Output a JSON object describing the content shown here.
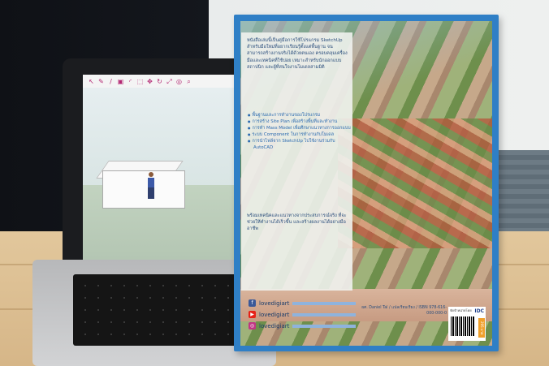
{
  "book": {
    "blurb_intro": "หนังสือเล่มนี้เป็นคู่มือการใช้โปรแกรม SketchUp สำหรับมือใหม่ที่อยากเรียนรู้ตั้งแต่พื้นฐาน จนสามารถสร้างงานจริงได้ด้วยตนเอง ครอบคลุมเครื่องมือและเทคนิคที่ใช้บ่อย เหมาะสำหรับนักออกแบบ สถาปนิก และผู้ที่สนใจงานโมเดลสามมิติ",
    "bullets": [
      "พื้นฐานและการทำงานของโปรแกรม",
      "การสร้าง Site Plan เพื่อสร้างพื้นที่และทำงาน",
      "การทำ Mass Model เพื่อศึกษาแนวทางการออกแบบ",
      "ระบบ Component ในการทำงานกับโมเดล",
      "การนำไฟล์จาก SketchUp ไปใช้งานร่วมกับ AutoCAD"
    ],
    "blurb_outro": "พร้อมเทคนิคและแนวทางจากประสบการณ์จริง ที่จะช่วยให้ทำงานได้เร็วขึ้น และสร้างผลงานได้อย่างมืออาชีพ",
    "social": [
      {
        "icon": "facebook-icon",
        "handle": "lovedigiart",
        "color": "#3b5998"
      },
      {
        "icon": "youtube-icon",
        "handle": "lovedigiart",
        "color": "#e62117"
      },
      {
        "icon": "instagram-icon",
        "handle": "lovedigiart",
        "color": "#c13584"
      }
    ],
    "credits": "ผศ. Daniel Tal / แปลเรียบเรียง / ISBN 978-616-000-000-0",
    "publisher_logo": "IDC",
    "pub_text": "จัดจำหน่ายโดย",
    "price_text": "295 บาท"
  },
  "laptop": {
    "app": "SketchUp"
  },
  "colors": {
    "book_border": "#2f7fc6",
    "text_blue": "#2c6bb0"
  }
}
